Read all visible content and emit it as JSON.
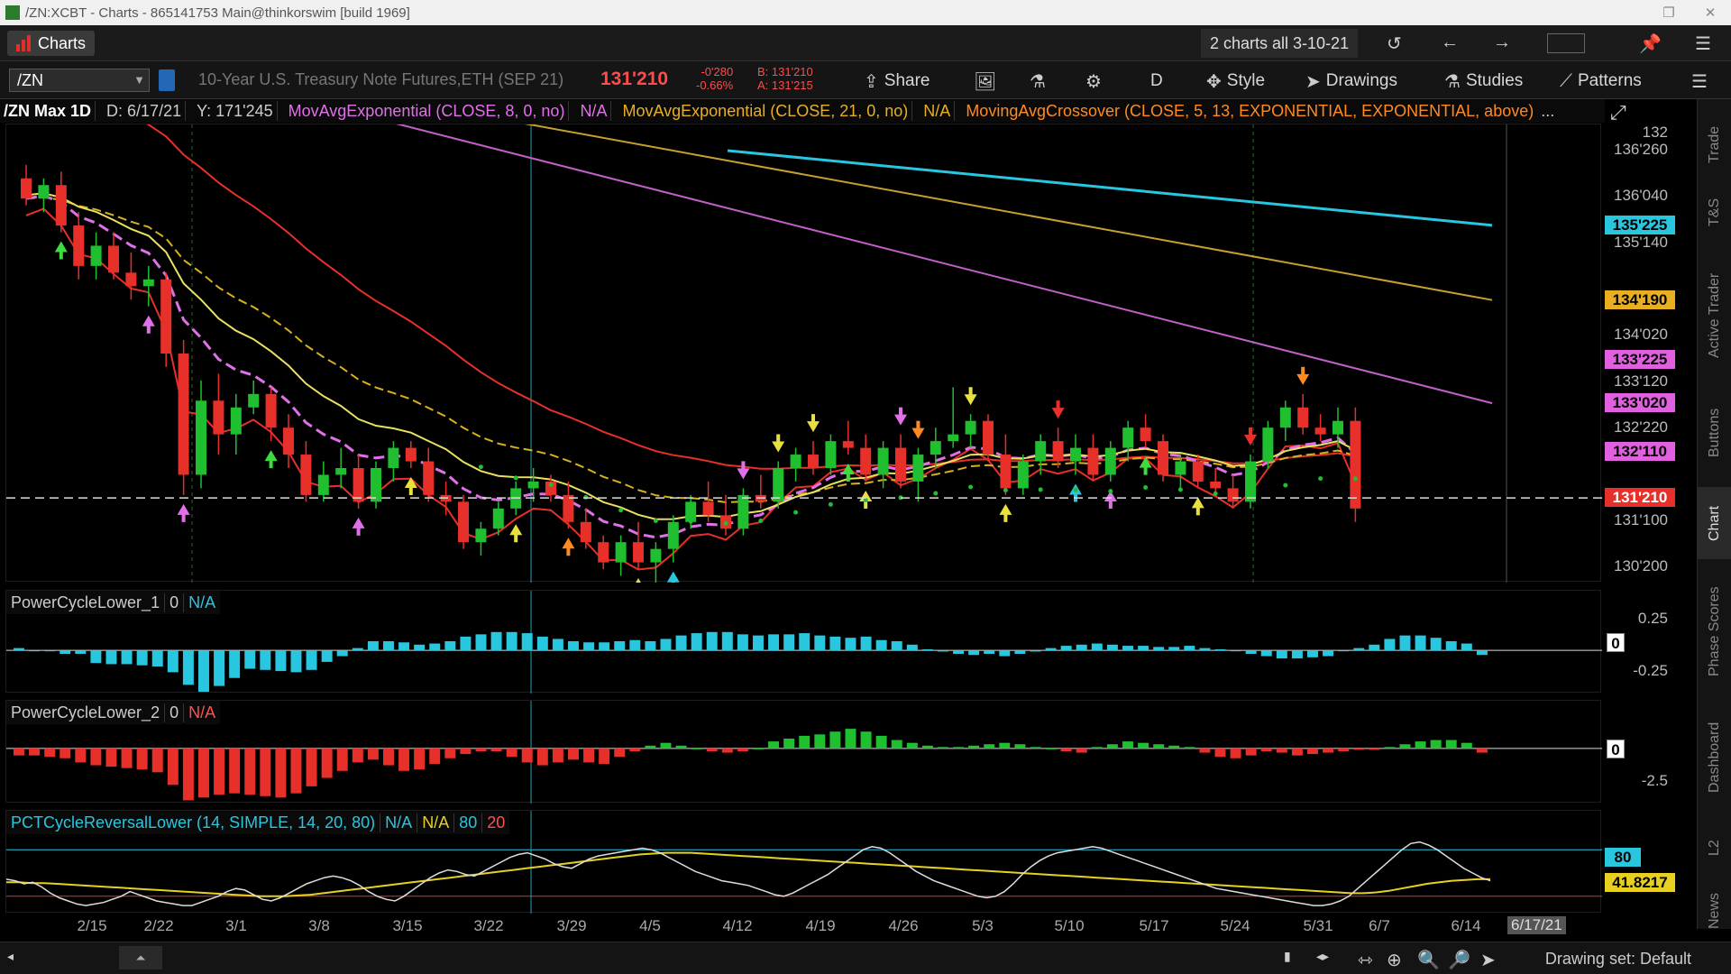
{
  "window": {
    "title": "/ZN:XCBT - Charts - 865141753 Main@thinkorswim [build 1969]",
    "buttons": [
      "❐",
      "✕"
    ]
  },
  "appbar": {
    "charts_tab": "Charts",
    "grid_label": "2 charts all 3-10-21",
    "swatch_colors": [
      "#ffffff",
      "#e0302a"
    ]
  },
  "toolbar": {
    "symbol": "/ZN",
    "description": "10-Year U.S. Treasury Note Futures,ETH (SEP 21)",
    "last": "131'210",
    "change": "-0'280",
    "change_pct": "-0.66%",
    "bid": "B: 131'210",
    "ask": "A: 131'215",
    "share": "Share",
    "aggregation": "D",
    "style": "Style",
    "drawings": "Drawings",
    "studies": "Studies",
    "patterns": "Patterns"
  },
  "study_header": {
    "title": "/ZN Max 1D",
    "date": "D: 6/17/21",
    "y": "Y: 171'245",
    "ema8": "MovAvgExponential (CLOSE, 8, 0, no)",
    "ema8_val": "N/A",
    "ema21": "MovAvgExponential (CLOSE, 21, 0, no)",
    "ema21_val": "N/A",
    "crossover": "MovingAvgCrossover (CLOSE, 5, 13, EXPONENTIAL, EXPONENTIAL, above)",
    "more": "..."
  },
  "price_axis": {
    "ticks": [
      "136'260",
      "136'040",
      "135'140",
      "134'020",
      "133'120",
      "132'220",
      "132",
      "131'100",
      "130'200"
    ],
    "tags": [
      {
        "text": "135'225",
        "color": "#29c6e0"
      },
      {
        "text": "134'190",
        "color": "#e8b020"
      },
      {
        "text": "133'225",
        "color": "#e060e0"
      },
      {
        "text": "133'020",
        "color": "#e060e0"
      },
      {
        "text": "132'110",
        "color": "#e060e0"
      },
      {
        "text": "131'210",
        "color": "#e8302a"
      }
    ]
  },
  "lower1": {
    "name": "PowerCycleLower_1",
    "zero": "0",
    "value": "N/A",
    "ticks": [
      "0.25",
      "-0.25"
    ],
    "tag": "0",
    "bar_values": [
      0.02,
      0.0,
      0.0,
      -0.03,
      -0.03,
      -0.11,
      -0.12,
      -0.12,
      -0.13,
      -0.14,
      -0.19,
      -0.3,
      -0.36,
      -0.31,
      -0.24,
      -0.16,
      -0.17,
      -0.18,
      -0.19,
      -0.17,
      -0.1,
      -0.05,
      0.02,
      0.08,
      0.08,
      0.07,
      0.05,
      0.06,
      0.08,
      0.12,
      0.14,
      0.16,
      0.16,
      0.15,
      0.12,
      0.1,
      0.08,
      0.07,
      0.07,
      0.08,
      0.09,
      0.08,
      0.1,
      0.13,
      0.15,
      0.16,
      0.16,
      0.14,
      0.13,
      0.14,
      0.14,
      0.15,
      0.13,
      0.12,
      0.11,
      0.12,
      0.09,
      0.08,
      0.05,
      0.01,
      -0.01,
      -0.03,
      -0.04,
      -0.03,
      -0.05,
      -0.03,
      -0.01,
      0.02,
      0.04,
      0.05,
      0.06,
      0.05,
      0.04,
      0.04,
      0.03,
      0.03,
      0.04,
      0.02,
      0.01,
      0.0,
      -0.03,
      -0.05,
      -0.07,
      -0.07,
      -0.06,
      -0.05,
      0.0,
      0.02,
      0.05,
      0.1,
      0.13,
      0.13,
      0.11,
      0.08,
      0.06,
      -0.04
    ],
    "ylim": [
      -0.36,
      0.3
    ]
  },
  "lower2": {
    "name": "PowerCycleLower_2",
    "zero": "0",
    "value": "N/A",
    "ticks": [
      "-2.5"
    ],
    "tag": "0",
    "bar_values": [
      -0.5,
      -0.5,
      -0.6,
      -0.7,
      -1.0,
      -1.2,
      -1.3,
      -1.4,
      -1.5,
      -1.7,
      -2.6,
      -3.7,
      -3.5,
      -3.3,
      -3.2,
      -3.3,
      -3.4,
      -3.5,
      -3.2,
      -2.7,
      -2.1,
      -1.6,
      -1.0,
      -0.8,
      -1.2,
      -1.6,
      -1.5,
      -1.1,
      -0.7,
      -0.4,
      -0.2,
      -0.2,
      -0.6,
      -1.0,
      -1.2,
      -1.0,
      -0.8,
      -1.0,
      -1.1,
      -0.6,
      -0.2,
      0.2,
      0.4,
      0.2,
      0.0,
      -0.2,
      -0.3,
      -0.2,
      0.0,
      0.5,
      0.7,
      0.9,
      1.0,
      1.2,
      1.4,
      1.2,
      0.9,
      0.6,
      0.4,
      0.2,
      0.1,
      0.1,
      0.2,
      0.3,
      0.4,
      0.3,
      0.1,
      0.0,
      -0.2,
      -0.3,
      0.1,
      0.3,
      0.5,
      0.4,
      0.3,
      0.2,
      0.1,
      -0.3,
      -0.6,
      -0.7,
      -0.5,
      -0.2,
      -0.3,
      -0.5,
      -0.4,
      -0.3,
      -0.2,
      -0.1,
      -0.1,
      0.1,
      0.3,
      0.5,
      0.6,
      0.6,
      0.4,
      -0.3
    ],
    "ylim": [
      -3.8,
      1.6
    ]
  },
  "lower3": {
    "name": "PCTCycleReversalLower (14, SIMPLE, 14, 20, 80)",
    "val1": "N/A",
    "val2": "N/A",
    "upper": "80",
    "lower": "20",
    "tags": [
      {
        "text": "80",
        "color": "#29c6e0"
      },
      {
        "text": "41.8217",
        "color": "#e8d020"
      }
    ],
    "ylim": [
      0,
      100
    ],
    "white": [
      42,
      40,
      36,
      38,
      32,
      24,
      18,
      14,
      10,
      8,
      10,
      12,
      16,
      20,
      26,
      22,
      18,
      14,
      12,
      10,
      8,
      8,
      12,
      16,
      20,
      26,
      30,
      28,
      22,
      16,
      14,
      18,
      24,
      30,
      36,
      40,
      44,
      46,
      44,
      40,
      34,
      26,
      20,
      16,
      14,
      20,
      28,
      36,
      44,
      50,
      54,
      52,
      48,
      46,
      52,
      58,
      64,
      70,
      74,
      76,
      72,
      68,
      62,
      58,
      56,
      62,
      68,
      72,
      74,
      76,
      78,
      80,
      82,
      80,
      76,
      70,
      64,
      58,
      52,
      48,
      44,
      40,
      38,
      36,
      34,
      30,
      26,
      22,
      20,
      24,
      30,
      36,
      42,
      48,
      56,
      64,
      72,
      80,
      84,
      82,
      76,
      68,
      60,
      52,
      46,
      40,
      36,
      32,
      28,
      24,
      20,
      18,
      20,
      26,
      36,
      48,
      58,
      66,
      72,
      76,
      78,
      80,
      82,
      84,
      82,
      78,
      74,
      70,
      66,
      62,
      58,
      54,
      50,
      46,
      42,
      38,
      34,
      30,
      28,
      26,
      24,
      22,
      20,
      18,
      16,
      14,
      12,
      10,
      8,
      8,
      10,
      14,
      20,
      30,
      40,
      50,
      60,
      70,
      80,
      88,
      90,
      86,
      80,
      72,
      64,
      56,
      50,
      44,
      40
    ],
    "yellow": [
      38,
      38,
      37,
      37,
      36,
      35,
      34,
      33,
      32,
      31,
      30,
      29,
      28,
      27,
      26,
      25,
      24,
      23,
      22,
      21,
      20,
      20,
      20,
      21,
      22,
      24,
      26,
      28,
      30,
      32,
      34,
      36,
      38,
      40,
      42,
      44,
      46,
      48,
      50,
      52,
      54,
      56,
      58,
      60,
      62,
      64,
      66,
      68,
      70,
      72,
      74,
      75,
      76,
      76,
      76,
      75,
      74,
      73,
      72,
      71,
      70,
      69,
      68,
      67,
      66,
      65,
      64,
      63,
      62,
      61,
      60,
      59,
      58,
      57,
      56,
      55,
      54,
      53,
      52,
      51,
      50,
      49,
      48,
      47,
      46,
      45,
      44,
      43,
      42,
      41,
      40,
      39,
      38,
      37,
      36,
      35,
      34,
      33,
      32,
      31,
      30,
      29,
      28,
      27,
      26,
      25,
      24,
      24,
      25,
      27,
      30,
      33,
      36,
      38,
      40,
      41,
      42,
      42
    ]
  },
  "xaxis": {
    "labels": [
      "2/15",
      "2/22",
      "3/1",
      "3/8",
      "3/15",
      "3/22",
      "3/29",
      "4/5",
      "4/12",
      "4/19",
      "4/26",
      "5/3",
      "5/10",
      "5/17",
      "5/24",
      "5/31",
      "6/7",
      "6/14"
    ],
    "cursor_label": "6/17/21"
  },
  "sidetabs": [
    "Trade",
    "T&S",
    "Active Trader",
    "Buttons",
    "Chart",
    "Phase Scores",
    "Dashboard",
    "L2",
    "News"
  ],
  "statusbar": {
    "drawing_set": "Drawing set: Default"
  },
  "chart_data": {
    "type": "candlestick",
    "symbol": "/ZN",
    "aggregation": "1D",
    "ylim": [
      "130'200",
      "136'260"
    ],
    "last_price": "131'210",
    "x_labels": [
      "2/15",
      "2/22",
      "3/1",
      "3/8",
      "3/15",
      "3/22",
      "3/29",
      "4/5",
      "4/12",
      "4/19",
      "4/26",
      "5/3",
      "5/10",
      "5/17",
      "5/24",
      "5/31",
      "6/7",
      "6/14"
    ],
    "candles_ohlc": [
      [
        136.4,
        136.6,
        136.0,
        136.1
      ],
      [
        136.1,
        136.4,
        135.9,
        136.3
      ],
      [
        136.3,
        136.5,
        135.6,
        135.7
      ],
      [
        135.7,
        135.9,
        134.9,
        135.1
      ],
      [
        135.1,
        135.6,
        134.9,
        135.4
      ],
      [
        135.4,
        135.6,
        134.9,
        135.0
      ],
      [
        135.0,
        135.3,
        134.6,
        134.8
      ],
      [
        134.8,
        135.1,
        134.5,
        134.9
      ],
      [
        134.9,
        135.0,
        133.6,
        133.8
      ],
      [
        133.8,
        134.0,
        131.7,
        132.0
      ],
      [
        132.0,
        133.4,
        131.8,
        133.1
      ],
      [
        133.1,
        133.5,
        132.3,
        132.6
      ],
      [
        132.6,
        133.2,
        132.3,
        133.0
      ],
      [
        133.0,
        133.4,
        132.9,
        133.2
      ],
      [
        133.2,
        133.3,
        132.5,
        132.7
      ],
      [
        132.7,
        132.9,
        132.1,
        132.3
      ],
      [
        132.3,
        132.5,
        131.6,
        131.7
      ],
      [
        131.7,
        132.2,
        131.6,
        132.0
      ],
      [
        132.0,
        132.4,
        131.8,
        132.1
      ],
      [
        132.1,
        132.3,
        131.5,
        131.6
      ],
      [
        131.6,
        132.2,
        131.5,
        132.1
      ],
      [
        132.1,
        132.5,
        131.9,
        132.4
      ],
      [
        132.4,
        132.5,
        132.1,
        132.2
      ],
      [
        132.2,
        132.4,
        131.6,
        131.7
      ],
      [
        131.7,
        131.9,
        131.4,
        131.6
      ],
      [
        131.6,
        131.7,
        130.9,
        131.0
      ],
      [
        131.0,
        131.3,
        130.8,
        131.2
      ],
      [
        131.2,
        131.6,
        131.1,
        131.5
      ],
      [
        131.5,
        131.9,
        131.4,
        131.8
      ],
      [
        131.8,
        132.1,
        131.6,
        131.9
      ],
      [
        131.9,
        132.0,
        131.6,
        131.7
      ],
      [
        131.7,
        131.9,
        131.2,
        131.3
      ],
      [
        131.3,
        131.5,
        130.9,
        131.0
      ],
      [
        131.0,
        131.1,
        130.6,
        130.7
      ],
      [
        130.7,
        131.1,
        130.5,
        131.0
      ],
      [
        131.0,
        131.3,
        130.6,
        130.7
      ],
      [
        130.7,
        131.0,
        130.4,
        130.9
      ],
      [
        130.9,
        131.4,
        130.7,
        131.3
      ],
      [
        131.3,
        131.7,
        131.2,
        131.6
      ],
      [
        131.6,
        131.9,
        131.3,
        131.4
      ],
      [
        131.4,
        131.7,
        131.1,
        131.2
      ],
      [
        131.2,
        131.8,
        131.1,
        131.7
      ],
      [
        131.7,
        132.0,
        131.5,
        131.6
      ],
      [
        131.6,
        132.2,
        131.5,
        132.1
      ],
      [
        132.1,
        132.4,
        131.9,
        132.3
      ],
      [
        132.3,
        132.5,
        132.0,
        132.1
      ],
      [
        132.1,
        132.6,
        132.0,
        132.5
      ],
      [
        132.5,
        132.8,
        132.3,
        132.4
      ],
      [
        132.4,
        132.6,
        131.9,
        132.0
      ],
      [
        132.0,
        132.5,
        131.8,
        132.4
      ],
      [
        132.4,
        132.6,
        131.8,
        131.9
      ],
      [
        131.9,
        132.4,
        131.6,
        132.3
      ],
      [
        132.3,
        132.7,
        132.1,
        132.5
      ],
      [
        132.5,
        133.3,
        132.4,
        132.6
      ],
      [
        132.6,
        132.9,
        132.4,
        132.8
      ],
      [
        132.8,
        132.9,
        132.2,
        132.3
      ],
      [
        132.3,
        132.6,
        131.7,
        131.8
      ],
      [
        131.8,
        132.3,
        131.7,
        132.2
      ],
      [
        132.2,
        132.6,
        132.0,
        132.5
      ],
      [
        132.5,
        132.7,
        132.1,
        132.2
      ],
      [
        132.2,
        132.6,
        132.0,
        132.4
      ],
      [
        132.4,
        132.6,
        131.9,
        132.0
      ],
      [
        132.0,
        132.5,
        131.9,
        132.4
      ],
      [
        132.4,
        132.8,
        132.2,
        132.7
      ],
      [
        132.7,
        132.9,
        132.4,
        132.5
      ],
      [
        132.5,
        132.6,
        131.9,
        132.0
      ],
      [
        132.0,
        132.3,
        131.8,
        132.2
      ],
      [
        132.2,
        132.3,
        131.8,
        131.9
      ],
      [
        131.9,
        132.1,
        131.7,
        131.8
      ],
      [
        131.8,
        132.0,
        131.5,
        131.6
      ],
      [
        131.6,
        132.3,
        131.5,
        132.2
      ],
      [
        132.2,
        132.8,
        132.1,
        132.7
      ],
      [
        132.7,
        133.1,
        132.5,
        133.0
      ],
      [
        133.0,
        133.2,
        132.6,
        132.7
      ],
      [
        132.7,
        132.9,
        132.5,
        132.6
      ],
      [
        132.6,
        133.0,
        132.4,
        132.8
      ],
      [
        132.8,
        133.0,
        131.3,
        131.5
      ]
    ],
    "overlay_lines": [
      {
        "color": "#29c6e0",
        "values_from_to": [
          "136'260",
          "135'225"
        ]
      },
      {
        "color": "#c8a030",
        "values_from_to": [
          "136'400",
          "134'190"
        ]
      },
      {
        "color": "#c060c8",
        "values_from_to": [
          "136'500",
          "133'020"
        ]
      }
    ]
  }
}
